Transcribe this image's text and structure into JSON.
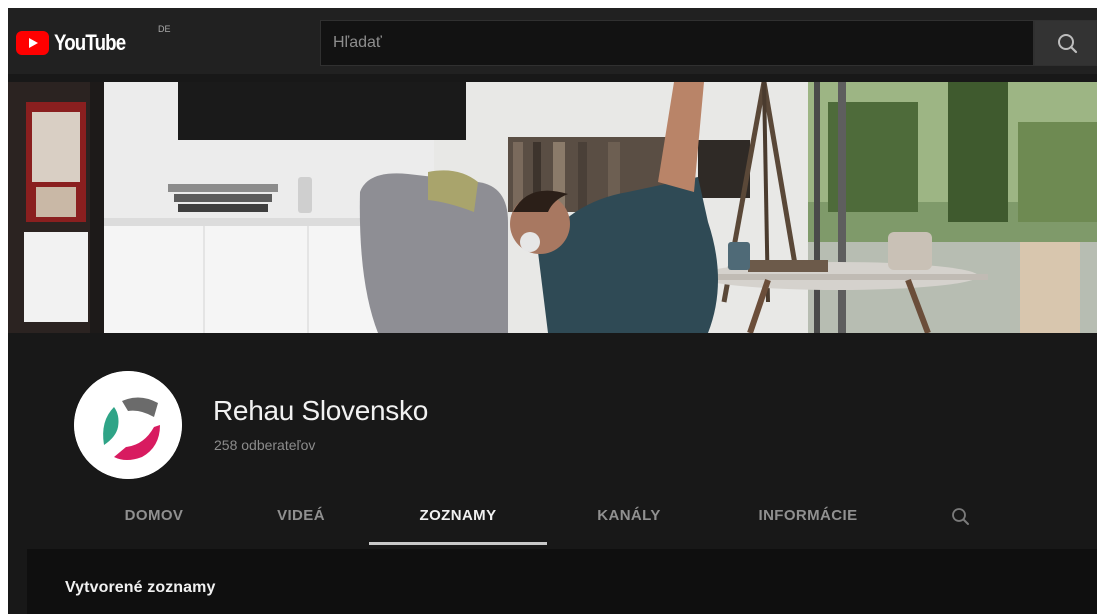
{
  "masthead": {
    "logo_text": "YouTube",
    "country_code": "DE",
    "search_placeholder": "Hľadať",
    "icons": {
      "logo": "youtube-play-icon",
      "search": "search-icon"
    }
  },
  "channel": {
    "name": "Rehau Slovensko",
    "subscribers": "258 odberateľov"
  },
  "tabs": [
    {
      "label": "DOMOV",
      "active": false
    },
    {
      "label": "VIDEÁ",
      "active": false
    },
    {
      "label": "ZOZNAMY",
      "active": true
    },
    {
      "label": "KANÁLY",
      "active": false
    },
    {
      "label": "INFORMÁCIE",
      "active": false
    }
  ],
  "section": {
    "title": "Vytvorené zoznamy"
  },
  "colors": {
    "brand_red": "#ff0000",
    "background": "#181818",
    "masthead": "#212121",
    "active_tab_underline": "#c9c9c9",
    "avatar_teal": "#2fa487",
    "avatar_pink": "#d81b60",
    "avatar_gray": "#6b6b6b"
  }
}
